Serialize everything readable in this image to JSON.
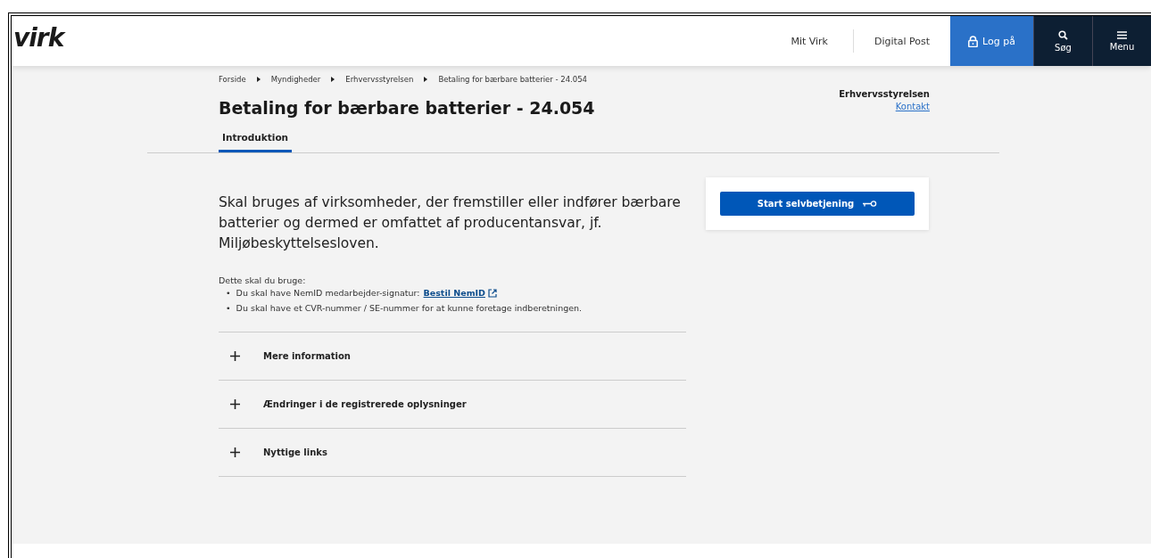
{
  "header": {
    "logo": "virk",
    "nav": [
      {
        "label": "Mit Virk",
        "kind": "link"
      },
      {
        "label": "Digital Post",
        "kind": "link"
      },
      {
        "label": "Log på",
        "kind": "login"
      },
      {
        "label": "Søg",
        "kind": "search"
      },
      {
        "label": "Menu",
        "kind": "menu"
      }
    ]
  },
  "breadcrumb": [
    "Forside",
    "Myndigheder",
    "Erhvervsstyrelsen",
    "Betaling for bærbare batterier - 24.054"
  ],
  "title": "Betaling for bærbare batterier - 24.054",
  "authority": {
    "name": "Erhvervsstyrelsen",
    "link": "Kontakt"
  },
  "tabs": [
    {
      "label": "Introduktion",
      "selected": true
    }
  ],
  "lead": "Skal bruges af virksomheder, der fremstiller eller indfører bærbare batterier og dermed er omfattet af producentansvar, jf. Miljøbeskyttelsesloven.",
  "requirements": {
    "heading": "Dette skal du bruge:",
    "bullet": "•",
    "items": [
      {
        "text": "Du skal have NemID medarbejder-signatur:",
        "link": "Bestil NemID"
      },
      {
        "text": "Du skal have et CVR-nummer / SE-nummer for at kunne foretage indberetningen."
      }
    ]
  },
  "start_button": "Start selvbetjening",
  "accordion": [
    {
      "label": "Mere information",
      "expanded": false
    },
    {
      "label": "Ændringer i de registrerede oplysninger",
      "expanded": false
    },
    {
      "label": "Nyttige links",
      "expanded": false
    }
  ]
}
